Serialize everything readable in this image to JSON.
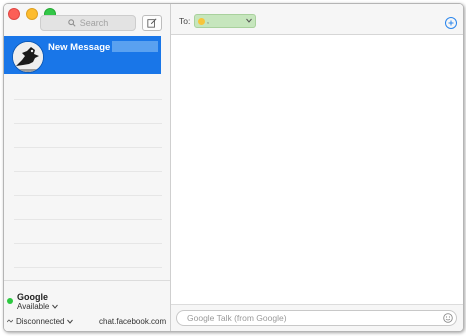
{
  "window": {
    "title": ""
  },
  "sidebar": {
    "search": {
      "placeholder": "Search",
      "icon": "search-icon"
    },
    "compose_icon": "compose-icon",
    "conversation": {
      "title": "New Message to",
      "selected": true,
      "highlight_color": "#1976e8"
    },
    "account": {
      "name": "Google",
      "status": "Available",
      "status_color": "#2cc840"
    },
    "footer": {
      "connection_status": "Disconnected",
      "server": "chat.facebook.com"
    }
  },
  "main": {
    "to_label": "To:",
    "recipient": {
      "separator": ",",
      "color": "#c6e6bd"
    },
    "add_icon": "add-contact-icon",
    "message_input": {
      "placeholder": "Google Talk (from Google)",
      "value": ""
    },
    "emoji_icon": "emoji-icon"
  }
}
